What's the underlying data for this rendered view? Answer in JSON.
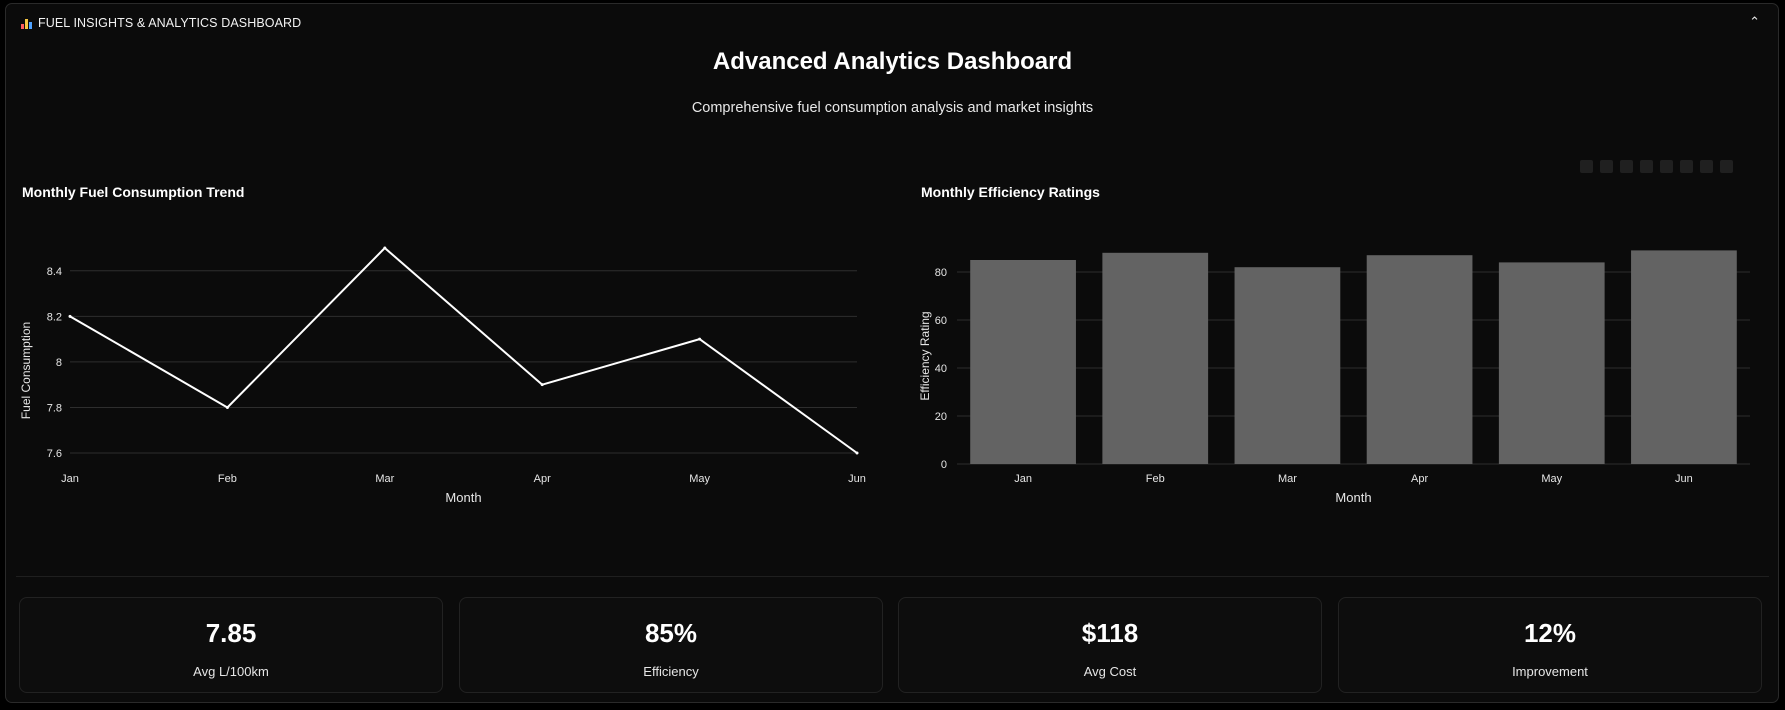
{
  "panel": {
    "header_title": "FUEL INSIGHTS & ANALYTICS DASHBOARD",
    "header_icon": "bar-chart-emoji-icon",
    "collapse_icon": "chevron-up-icon"
  },
  "page": {
    "title": "Advanced Analytics Dashboard",
    "subtitle": "Comprehensive fuel consumption analysis and market insights"
  },
  "modebar": {
    "icons": [
      "camera-icon",
      "zoom-icon",
      "pan-icon",
      "zoom-in-icon",
      "zoom-out-icon",
      "autoscale-icon",
      "home-icon",
      "fullscreen-icon"
    ]
  },
  "chart_data": [
    {
      "type": "line",
      "title": "Monthly Fuel Consumption Trend",
      "x": [
        "Jan",
        "Feb",
        "Mar",
        "Apr",
        "May",
        "Jun"
      ],
      "series": [
        {
          "values": [
            8.2,
            7.8,
            8.5,
            7.9,
            8.1,
            7.6
          ]
        }
      ],
      "xlabel": "Month",
      "ylabel": "Fuel Consumption",
      "yticks": [
        "7.6",
        "7.8",
        "8",
        "8.2",
        "8.4"
      ],
      "ylim": [
        7.6,
        8.5
      ],
      "grid": true,
      "line_color": "#ffffff"
    },
    {
      "type": "bar",
      "title": "Monthly Efficiency Ratings",
      "categories": [
        "Jan",
        "Feb",
        "Mar",
        "Apr",
        "May",
        "Jun"
      ],
      "values": [
        85,
        88,
        82,
        87,
        84,
        89
      ],
      "xlabel": "Month",
      "ylabel": "Efficiency Rating",
      "yticks": [
        "0",
        "20",
        "40",
        "60",
        "80"
      ],
      "ylim": [
        0,
        90
      ],
      "grid": true,
      "bar_color": "#636363"
    }
  ],
  "stats": [
    {
      "value": "7.85",
      "label": "Avg L/100km"
    },
    {
      "value": "85%",
      "label": "Efficiency"
    },
    {
      "value": "$118",
      "label": "Avg Cost"
    },
    {
      "value": "12%",
      "label": "Improvement"
    }
  ],
  "colors": {
    "background": "#0b0b0b",
    "grid": "#2e2e2e",
    "text": "#ffffff"
  }
}
